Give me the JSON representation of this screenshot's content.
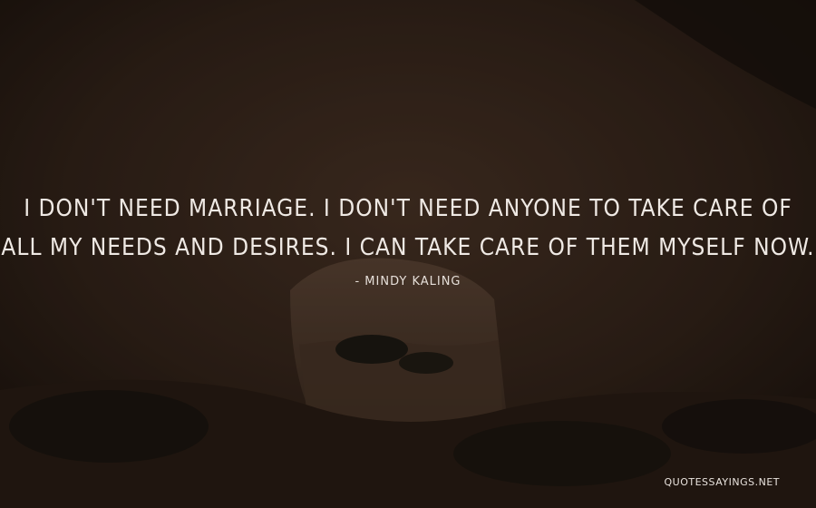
{
  "quote": {
    "line1": "I DON'T NEED MARRIAGE. I DON'T NEED ANYONE TO TAKE CARE OF",
    "line2": "ALL MY NEEDS AND DESIRES. I CAN TAKE CARE OF THEM MYSELF NOW.",
    "author": "- MINDY KALING"
  },
  "watermark": "QUOTESSAYINGS.NET",
  "colors": {
    "rock": "#3b2a20",
    "sky_opening": "#5b4434",
    "text": "#efe9e4"
  }
}
